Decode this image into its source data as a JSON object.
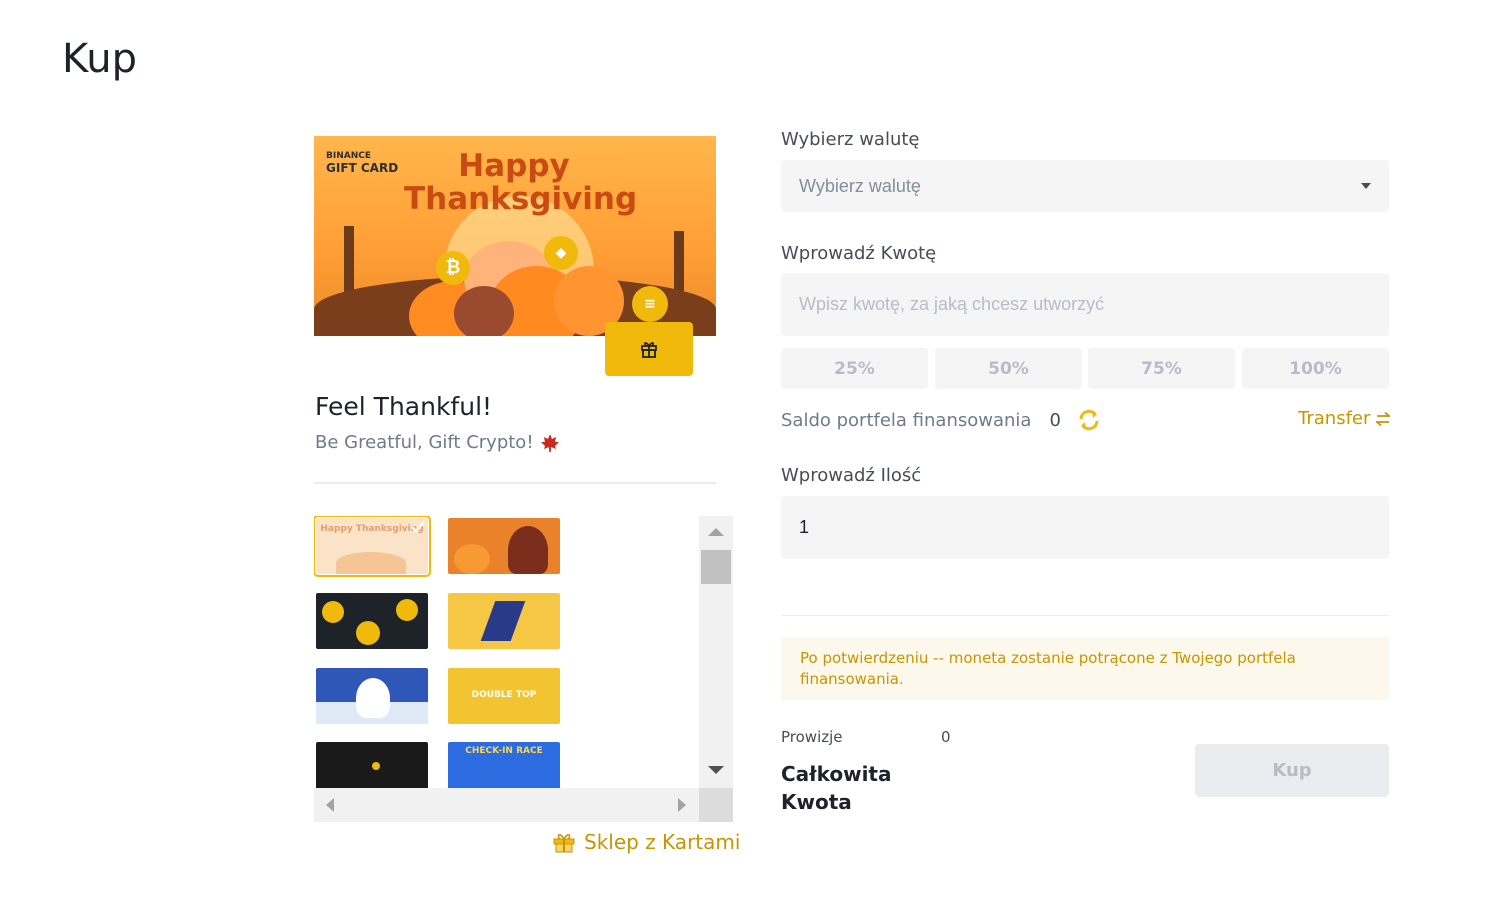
{
  "page": {
    "title": "Kup"
  },
  "card": {
    "brand_line1": "BINANCE",
    "brand_line2": "GIFT CARD",
    "headline_line1": "Happy",
    "headline_line2": "Thanksgiving",
    "title": "Feel Thankful!",
    "subtitle": "Be Greatful, Gift Crypto!",
    "subtitle_icon": "maple-leaf-icon"
  },
  "thumbnails": [
    {
      "name": "thanksgiving-pumpkins",
      "label": "Happy Thanksgiving",
      "selected": true,
      "bg": "#fbe3c8",
      "fg": "#f0a860"
    },
    {
      "name": "thanksgiving-turkey",
      "label": "",
      "selected": false,
      "bg": "#e9822a",
      "fg": "#7a2e1b"
    },
    {
      "name": "black-gold-coins",
      "label": "",
      "selected": false,
      "bg": "#1e2329",
      "fg": "#f0b90b"
    },
    {
      "name": "yellow-skier",
      "label": "",
      "selected": false,
      "bg": "#f6c744",
      "fg": "#2a3a8a"
    },
    {
      "name": "polar-bear-snow",
      "label": "",
      "selected": false,
      "bg": "#2e57b8",
      "fg": "#ffffff"
    },
    {
      "name": "double-top",
      "label": "DOUBLE TOP",
      "selected": false,
      "bg": "#f3c431",
      "fg": "#ffffff"
    },
    {
      "name": "dark-night",
      "label": "",
      "selected": false,
      "bg": "#1a1a1a",
      "fg": "#f0b90b"
    },
    {
      "name": "check-in-race",
      "label": "CHECK-IN RACE",
      "selected": false,
      "bg": "#2d6be0",
      "fg": "#ffd84a"
    }
  ],
  "shop_link": {
    "label": "Sklep z Kartami",
    "icon": "gift-shop-icon"
  },
  "form": {
    "currency": {
      "label": "Wybierz walutę",
      "placeholder": "Wybierz walutę"
    },
    "amount": {
      "label": "Wprowadź Kwotę",
      "placeholder": "Wpisz kwotę, za jaką chcesz utworzyć"
    },
    "percent_buttons": [
      "25%",
      "50%",
      "75%",
      "100%"
    ],
    "balance": {
      "label": "Saldo portfela finansowania",
      "value": "0"
    },
    "transfer_label": "Transfer",
    "quantity": {
      "label": "Wprowadź Ilość",
      "value": "1"
    },
    "notice": "Po potwierdzeniu -- moneta zostanie potrącone z Twojego portfela finansowania.",
    "fee": {
      "label": "Prowizje",
      "value": "0"
    },
    "total": {
      "label": "Całkowita Kwota"
    },
    "buy_label": "Kup"
  },
  "colors": {
    "accent": "#f0b90b",
    "link": "#c99400",
    "field_bg": "#f5f5f5"
  }
}
